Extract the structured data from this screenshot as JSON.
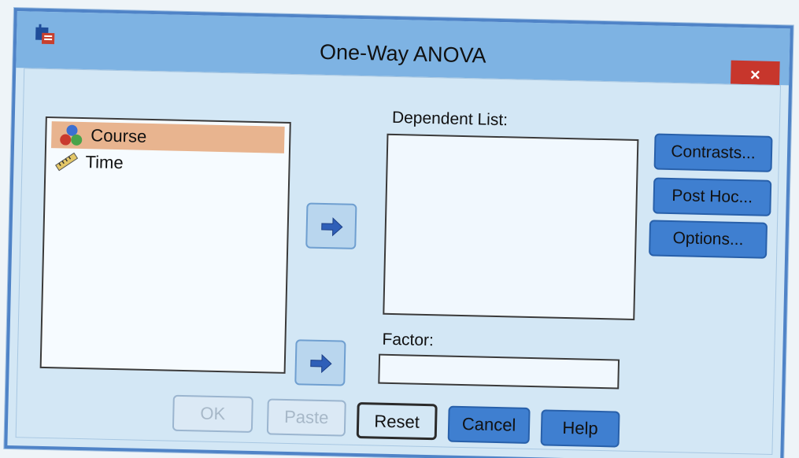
{
  "window": {
    "title": "One-Way ANOVA",
    "close_glyph": "×",
    "app_icon": "spss-dialog-icon"
  },
  "variables": [
    {
      "label": "Course",
      "icon": "nominal-variable-icon",
      "selected": true
    },
    {
      "label": "Time",
      "icon": "scale-variable-icon",
      "selected": false
    }
  ],
  "dependent": {
    "label": "Dependent List:"
  },
  "factor": {
    "label": "Factor:",
    "value": ""
  },
  "side_buttons": {
    "contrasts": "Contrasts...",
    "post_hoc": "Post Hoc...",
    "options": "Options..."
  },
  "bottom_buttons": {
    "ok": "OK",
    "paste": "Paste",
    "reset": "Reset",
    "cancel": "Cancel",
    "help": "Help"
  },
  "colors": {
    "titlebar": "#7eb3e3",
    "dialog_bg": "#d3e7f5",
    "button_blue": "#3f7fd0",
    "selected_row": "#e8b48f",
    "close_red": "#c7362c"
  }
}
